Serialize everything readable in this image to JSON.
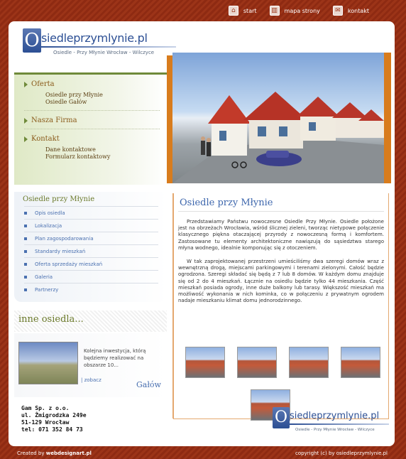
{
  "topnav": [
    {
      "label": "start",
      "icon": "home-icon"
    },
    {
      "label": "mapa strony",
      "icon": "sitemap-icon"
    },
    {
      "label": "kontakt",
      "icon": "mail-icon"
    }
  ],
  "header": {
    "logo_letter": "O",
    "logo_text": "siedleprzymlynie.pl",
    "tagline": "Osiedle - Przy Młynie Wrocław - Wilczyce"
  },
  "menu": {
    "sections": [
      {
        "label": "Oferta",
        "items": [
          "Osiedle przy Młynie",
          "Osiedle Gałów"
        ]
      },
      {
        "label": "Nasza Firma",
        "items": []
      },
      {
        "label": "Kontakt",
        "items": [
          "Dane kontaktowe",
          "Formularz kontaktowy"
        ]
      }
    ]
  },
  "sidebar": {
    "title": "Osiedle przy Młynie",
    "items": [
      "Opis osiedla",
      "Lokalizacja",
      "Plan zagospodarowania",
      "Standardy mieszkań",
      "Oferta sprzedaży mieszkań",
      "Galeria",
      "Partnerzy"
    ]
  },
  "inne": {
    "title": "inne osiedla...",
    "text": "Kolejna inwestycja, którą będziemy realizować na obszarze 10...",
    "link": "| zobacz",
    "name": "Gałów"
  },
  "content": {
    "title": "Osiedle przy Młynie",
    "paragraphs": [
      "Przedstawiamy Państwu nowoczesne Osiedle Przy Młynie. Osiedle położone jest na obrzeżach Wrocławia, wśród ślicznej zieleni, tworząc nietypowe połączenie klasycznego piękna otaczającej przyrody z nowoczesną formą i komfortem. Zastosowane tu elementy architektoniczne nawiązują do sąsiedztwa starego młyna wodnego, idealnie komponując się z otoczeniem.",
      "W tak zaprojektowanej przestrzeni umieściliśmy dwa szeregi domów wraz z wewnętrzną drogą, miejscami parkingowymi i terenami zielonymi. Całość będzie ogrodzona. Szeregi składać się będą z 7 lub 8 domów. W każdym domu znajduje się od 2 do 4 mieszkań. Łącznie na osiedlu będzie tylko 44 mieszkania. Część mieszkań posiada ogrody, inne duże balkony lub tarasy. Większość mieszkań ma możliwość wykonania w nich kominka, co w połączeniu z prywatnym ogrodem nadaje mieszkaniu klimat domu jednorodzinnego."
    ]
  },
  "footer": {
    "address": [
      "Gam Sp. z o.o.",
      "ul. Żmigrodzka 249e",
      "51-129 Wrocław",
      "tel: 071 352 84 73"
    ],
    "logo_letter": "O",
    "logo_text": "siedleprzymlynie.pl",
    "logo_tagline": "Osiedle - Przy Młynie Wrocław - Wilczyce",
    "created_by_prefix": "Created by",
    "created_by": "webdesignart.pl",
    "copyright": "copyright (c) by osiedleprzymlynie.pl"
  },
  "colors": {
    "accent": "#3e67ad",
    "brand_bg": "#9c3418",
    "green": "#6b7a2b",
    "orange": "#d87c1d"
  }
}
